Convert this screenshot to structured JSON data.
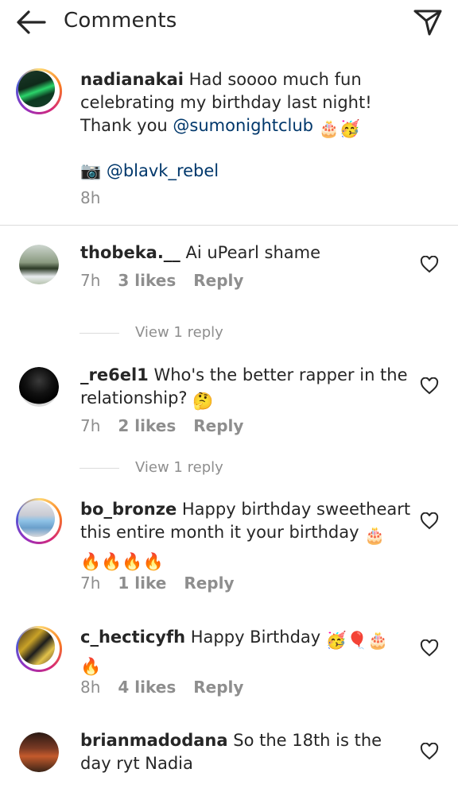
{
  "header": {
    "title": "Comments",
    "back_icon": "arrow-left-icon",
    "send_icon": "paper-plane-icon"
  },
  "caption": {
    "username": "nadianakai",
    "text": "Had soooo much fun celebrating my birthday last night! Thank you ",
    "mention": "@sumonightclub",
    "emojis": "🎂🥳",
    "credit_icon": "📷",
    "credit_mention": "@blavk_rebel",
    "time": "8h"
  },
  "comments": [
    {
      "username": "thobeka.__",
      "text": "Ai uPearl shame",
      "time": "7h",
      "likes": "3 likes",
      "reply": "Reply",
      "view_replies": "View 1 reply"
    },
    {
      "username": "_re6el1",
      "text": "Who's the better rapper in the relationship?",
      "emoji": "🤔",
      "time": "7h",
      "likes": "2 likes",
      "reply": "Reply",
      "view_replies": "View 1 reply"
    },
    {
      "username": "bo_bronze",
      "text": "Happy birthday sweetheart this entire month it your birthday",
      "emoji": "🎂",
      "emoji2": "🔥🔥🔥🔥",
      "time": "7h",
      "likes": "1 like",
      "reply": "Reply"
    },
    {
      "username": "c_hecticyfh",
      "text": "Happy Birthday",
      "emoji": "🥳🎈🎂",
      "emoji2": "🔥",
      "time": "8h",
      "likes": "4 likes",
      "reply": "Reply"
    },
    {
      "username": "brianmadodana",
      "text": "So the 18th is the day ryt Nadia"
    }
  ]
}
